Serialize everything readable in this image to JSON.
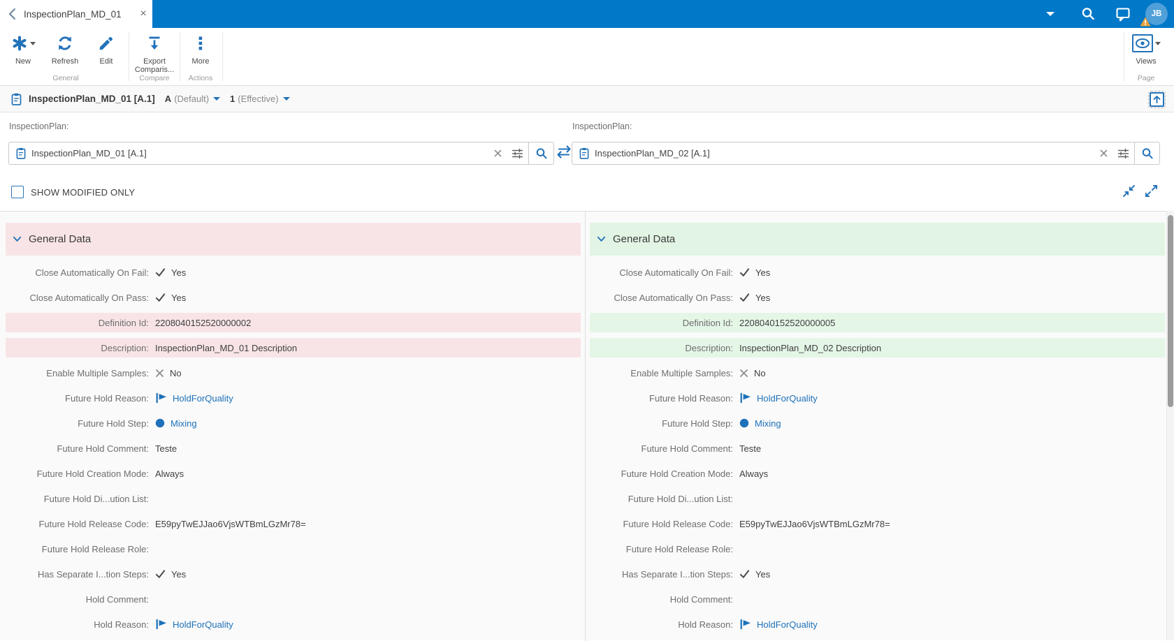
{
  "colors": {
    "header_blue": "#0278c8",
    "accent_blue": "#2272b9",
    "link_blue": "#1d71b8",
    "diff_removed_bg": "#f8e4e6",
    "diff_added_bg": "#e4f6e6"
  },
  "icons": {
    "back": "chevron-left",
    "close": "x",
    "user_menu": "caret-down",
    "search": "magnifier",
    "feedback": "speech-bubble",
    "warning": "orange-triangle-exclamation",
    "new": "asterisk",
    "refresh": "circular-arrows",
    "edit": "pencil",
    "export": "download-arrow-with-bar",
    "more": "vertical-ellipsis",
    "views": "eye-in-box",
    "entity": "clipboard",
    "clear": "x",
    "filter": "sliders",
    "swap": "horizontal-arrows",
    "collapse_all": "arrows-inward",
    "expand_all": "arrows-outward",
    "scroll_top": "arrow-up-in-box",
    "check": "checkmark",
    "cross": "x-mark",
    "flag": "solid-flag",
    "step": "solid-circle"
  },
  "tab_bar": {
    "title": "InspectionPlan_MD_01",
    "avatar_initials": "JB"
  },
  "toolbar": {
    "new_label": "New",
    "refresh_label": "Refresh",
    "edit_label": "Edit",
    "export_label_line1": "Export",
    "export_label_line2": "Comparis...",
    "more_label": "More",
    "views_label": "Views",
    "group_general": "General",
    "group_compare": "Compare",
    "group_actions": "Actions",
    "group_page": "Page"
  },
  "breadcrumb": {
    "title": "InspectionPlan_MD_01 [A.1]",
    "revision_value": "A",
    "revision_label": "(Default)",
    "version_value": "1",
    "version_label": "(Effective)"
  },
  "selectors": {
    "left": {
      "label": "InspectionPlan:",
      "value": "InspectionPlan_MD_01 [A.1]"
    },
    "right": {
      "label": "InspectionPlan:",
      "value": "InspectionPlan_MD_02 [A.1]"
    }
  },
  "filters": {
    "show_modified_label": "SHOW MODIFIED ONLY",
    "show_modified_checked": false
  },
  "panels": {
    "left": {
      "section_title": "General Data",
      "rows": [
        {
          "label": "Close Automatically On Fail:",
          "type": "check",
          "value": "Yes",
          "highlight": false
        },
        {
          "label": "Close Automatically On Pass:",
          "type": "check",
          "value": "Yes",
          "highlight": false
        },
        {
          "label": "Definition Id:",
          "type": "text",
          "value": "2208040152520000002",
          "highlight": true
        },
        {
          "label": "Description:",
          "type": "text",
          "value": "InspectionPlan_MD_01 Description",
          "highlight": true
        },
        {
          "label": "Enable Multiple Samples:",
          "type": "cross",
          "value": "No",
          "highlight": false
        },
        {
          "label": "Future Hold Reason:",
          "type": "flag",
          "value": "HoldForQuality",
          "highlight": false
        },
        {
          "label": "Future Hold Step:",
          "type": "step",
          "value": "Mixing",
          "highlight": false
        },
        {
          "label": "Future Hold Comment:",
          "type": "text",
          "value": "Teste",
          "highlight": false
        },
        {
          "label": "Future Hold Creation Mode:",
          "type": "text",
          "value": "Always",
          "highlight": false
        },
        {
          "label": "Future Hold Di...ution List:",
          "type": "empty",
          "value": "",
          "highlight": false
        },
        {
          "label": "Future Hold Release Code:",
          "type": "text",
          "value": "E59pyTwEJJao6VjsWTBmLGzMr78=",
          "highlight": false
        },
        {
          "label": "Future Hold Release Role:",
          "type": "empty",
          "value": "",
          "highlight": false
        },
        {
          "label": "Has Separate I...tion Steps:",
          "type": "check",
          "value": "Yes",
          "highlight": false
        },
        {
          "label": "Hold Comment:",
          "type": "empty",
          "value": "",
          "highlight": false
        },
        {
          "label": "Hold Reason:",
          "type": "flag",
          "value": "HoldForQuality",
          "highlight": false
        }
      ]
    },
    "right": {
      "section_title": "General Data",
      "rows": [
        {
          "label": "Close Automatically On Fail:",
          "type": "check",
          "value": "Yes",
          "highlight": false
        },
        {
          "label": "Close Automatically On Pass:",
          "type": "check",
          "value": "Yes",
          "highlight": false
        },
        {
          "label": "Definition Id:",
          "type": "text",
          "value": "2208040152520000005",
          "highlight": true
        },
        {
          "label": "Description:",
          "type": "text",
          "value": "InspectionPlan_MD_02 Description",
          "highlight": true
        },
        {
          "label": "Enable Multiple Samples:",
          "type": "cross",
          "value": "No",
          "highlight": false
        },
        {
          "label": "Future Hold Reason:",
          "type": "flag",
          "value": "HoldForQuality",
          "highlight": false
        },
        {
          "label": "Future Hold Step:",
          "type": "step",
          "value": "Mixing",
          "highlight": false
        },
        {
          "label": "Future Hold Comment:",
          "type": "text",
          "value": "Teste",
          "highlight": false
        },
        {
          "label": "Future Hold Creation Mode:",
          "type": "text",
          "value": "Always",
          "highlight": false
        },
        {
          "label": "Future Hold Di...ution List:",
          "type": "empty",
          "value": "",
          "highlight": false
        },
        {
          "label": "Future Hold Release Code:",
          "type": "text",
          "value": "E59pyTwEJJao6VjsWTBmLGzMr78=",
          "highlight": false
        },
        {
          "label": "Future Hold Release Role:",
          "type": "empty",
          "value": "",
          "highlight": false
        },
        {
          "label": "Has Separate I...tion Steps:",
          "type": "check",
          "value": "Yes",
          "highlight": false
        },
        {
          "label": "Hold Comment:",
          "type": "empty",
          "value": "",
          "highlight": false
        },
        {
          "label": "Hold Reason:",
          "type": "flag",
          "value": "HoldForQuality",
          "highlight": false
        }
      ]
    }
  }
}
